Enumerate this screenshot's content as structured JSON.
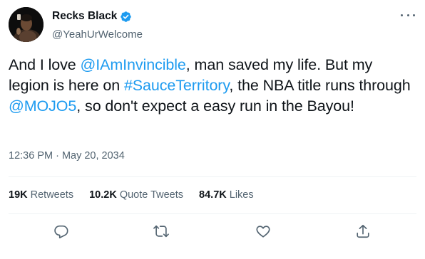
{
  "author": {
    "display_name": "Recks Black",
    "handle": "@YeahUrWelcome",
    "verified": true
  },
  "tweet": {
    "segments": [
      {
        "text": "And I love ",
        "type": "text"
      },
      {
        "text": "@IAmInvincible",
        "type": "mention"
      },
      {
        "text": ", man saved my life. But my legion is here on ",
        "type": "text"
      },
      {
        "text": "#SauceTerritory",
        "type": "hashtag"
      },
      {
        "text": ", the NBA title runs through ",
        "type": "text"
      },
      {
        "text": "@MOJO5",
        "type": "mention"
      },
      {
        "text": ", so don't expect a easy run in the Bayou!",
        "type": "text"
      }
    ],
    "timestamp": "12:36 PM · May 20, 2034"
  },
  "stats": {
    "retweets": {
      "count": "19K",
      "label": "Retweets"
    },
    "quotes": {
      "count": "10.2K",
      "label": "Quote Tweets"
    },
    "likes": {
      "count": "84.7K",
      "label": "Likes"
    }
  },
  "actions": [
    "reply-icon",
    "retweet-icon",
    "like-icon",
    "share-icon"
  ],
  "colors": {
    "link": "#1d9bf0",
    "secondary_text": "#536471",
    "primary_text": "#0f1419",
    "divider": "#eff3f4"
  }
}
